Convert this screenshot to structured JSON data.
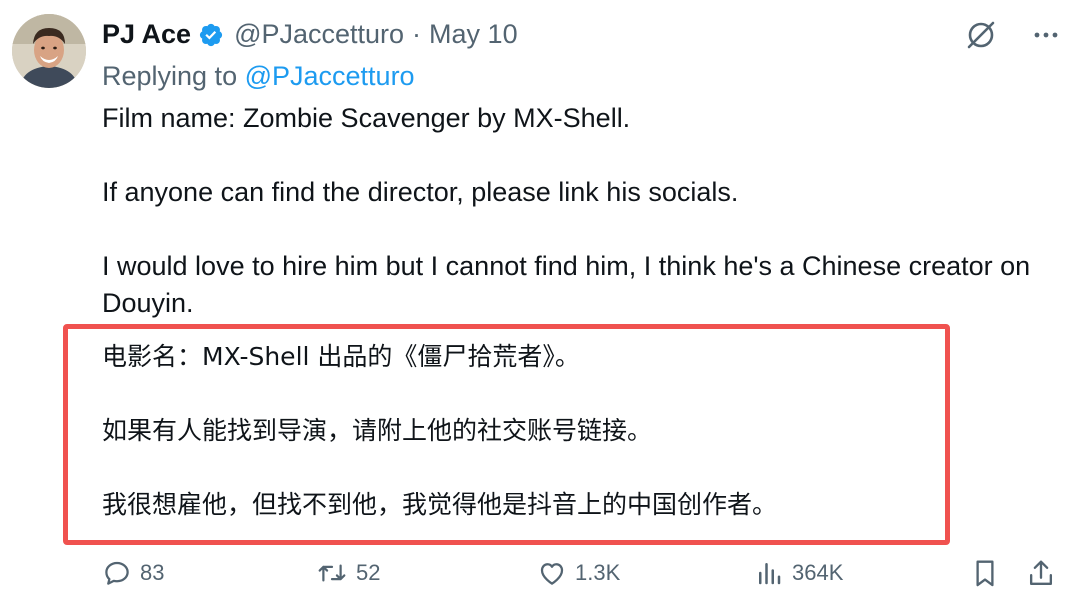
{
  "author": {
    "display_name": "PJ Ace",
    "handle": "@PJaccetturo",
    "separator": "·",
    "date": "May 10"
  },
  "reply": {
    "prefix": "Replying to ",
    "mention": "@PJaccetturo"
  },
  "body_en": [
    "Film name: Zombie Scavenger by MX-Shell.",
    "If anyone can find the director, please link his socials.",
    "I would love to hire him but I cannot find him, I think he's a Chinese creator on Douyin."
  ],
  "body_cn": [
    "电影名：MX-Shell 出品的《僵尸拾荒者》。",
    "如果有人能找到导演，请附上他的社交账号链接。",
    "我很想雇他，但找不到他，我觉得他是抖音上的中国创作者。"
  ],
  "actions": {
    "replies": "83",
    "reposts": "52",
    "likes": "1.3K",
    "views": "364K"
  },
  "colors": {
    "text": "#0f1419",
    "muted": "#536471",
    "link": "#1d9bf0",
    "highlight_border": "#f0524f"
  },
  "icons": [
    "verified-badge-icon",
    "grok-icon",
    "more-icon",
    "reply-icon",
    "repost-icon",
    "like-icon",
    "views-icon",
    "bookmark-icon",
    "share-icon"
  ]
}
